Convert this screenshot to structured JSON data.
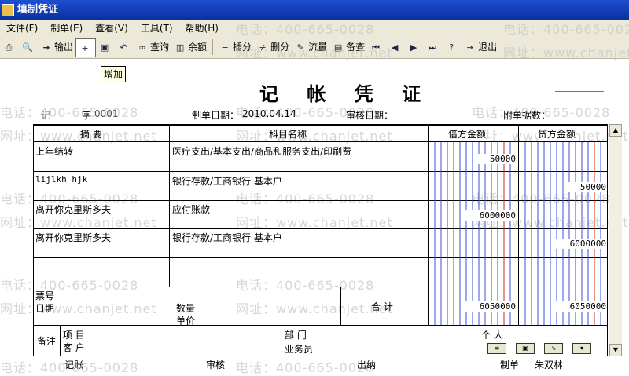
{
  "window": {
    "title": "填制凭证"
  },
  "menu": [
    "文件(F)",
    "制单(E)",
    "查看(V)",
    "工具(T)",
    "帮助(H)"
  ],
  "toolbar": {
    "output": "输出",
    "query": "查询",
    "balance": "余额",
    "insert": "插分",
    "delete": "删分",
    "flow": "流量",
    "remark": "备查",
    "exit": "退出"
  },
  "tooltip": "增加",
  "voucher": {
    "title": "记 帐 凭 证",
    "type": "记",
    "number_label": "字",
    "number": "0001",
    "date_label": "制单日期：",
    "date": "2010.04.14",
    "audit_date_label": "审核日期：",
    "attach_label": "附单据数：",
    "columns": {
      "summary": "摘 要",
      "account": "科目名称",
      "debit": "借方金额",
      "credit": "贷方金额"
    },
    "rows": [
      {
        "summary": "上年结转",
        "account": "医疗支出/基本支出/商品和服务支出/印刷费",
        "debit": "50000",
        "credit": ""
      },
      {
        "summary": "lijlkh hjk",
        "account": "银行存款/工商银行 基本户",
        "debit": "",
        "credit": "50000"
      },
      {
        "summary": "离开你克里斯多夫",
        "account": "应付账款",
        "debit": "6000000",
        "credit": ""
      },
      {
        "summary": "离开你克里斯多夫",
        "account": "银行存款/工商银行 基本户",
        "debit": "",
        "credit": "6000000"
      }
    ],
    "ticket_no_label": "票号",
    "date_label2": "日期",
    "quantity_label": "数量",
    "unit_price_label": "单价",
    "total_label": "合 计",
    "total_debit": "6050000",
    "total_credit": "6050000",
    "remark_label": "备注",
    "project_label": "项 目",
    "department_label": "部 门",
    "person_label": "个 人",
    "customer_label": "客 户",
    "salesman_label": "业务员"
  },
  "footer": {
    "bookkeeping": "记账",
    "audit": "审核",
    "cashier": "出纳",
    "maker_label": "制单",
    "maker": "朱双林"
  },
  "watermarks": {
    "phone": "电话：400-665-0028",
    "site": "网址：www.chanjet.net"
  }
}
